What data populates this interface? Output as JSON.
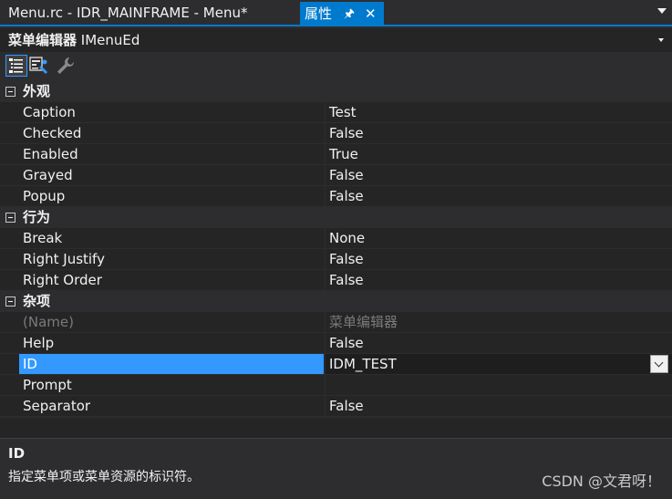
{
  "tabs": {
    "document": "Menu.rc - IDR_MAINFRAME - Menu*",
    "active": "属性"
  },
  "object": {
    "kind": "菜单编辑器",
    "name": "IMenuEd"
  },
  "toolbar": {
    "icons": [
      "categorized-icon",
      "property-pages-icon",
      "wrench-icon"
    ]
  },
  "categories": {
    "appearance": "外观",
    "behavior": "行为",
    "misc": "杂项"
  },
  "props": {
    "caption": {
      "name": "Caption",
      "value": "Test"
    },
    "checked": {
      "name": "Checked",
      "value": "False"
    },
    "enabled": {
      "name": "Enabled",
      "value": "True"
    },
    "grayed": {
      "name": "Grayed",
      "value": "False"
    },
    "popup": {
      "name": "Popup",
      "value": "False"
    },
    "break": {
      "name": "Break",
      "value": "None"
    },
    "right_justify": {
      "name": "Right Justify",
      "value": "False"
    },
    "right_order": {
      "name": "Right Order",
      "value": "False"
    },
    "name": {
      "name": "(Name)",
      "value": "菜单编辑器"
    },
    "help": {
      "name": "Help",
      "value": "False"
    },
    "id": {
      "name": "ID",
      "value": "IDM_TEST"
    },
    "prompt": {
      "name": "Prompt",
      "value": ""
    },
    "separator": {
      "name": "Separator",
      "value": "False"
    }
  },
  "description": {
    "title": "ID",
    "text": "指定菜单项或菜单资源的标识符。"
  },
  "watermark": "CSDN @文君呀！",
  "colors": {
    "accent": "#007acc",
    "selection": "#3399ff",
    "background": "#2d2d30",
    "grid": "#252526"
  }
}
